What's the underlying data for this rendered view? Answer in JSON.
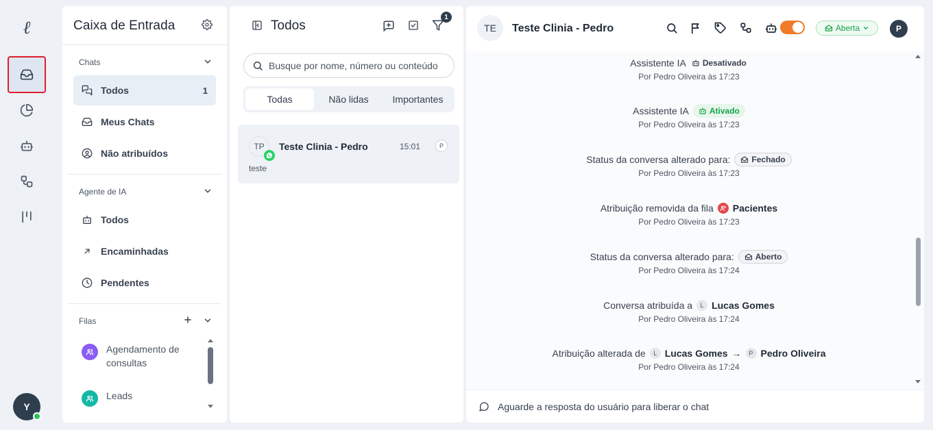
{
  "rail": {
    "logo": "ℓ",
    "items": [
      {
        "icon": "inbox-icon",
        "active": true
      },
      {
        "icon": "pie-chart-icon"
      },
      {
        "icon": "bot-icon"
      },
      {
        "icon": "workflow-icon"
      },
      {
        "icon": "kanban-icon"
      }
    ],
    "user_initial": "Y"
  },
  "inbox": {
    "title": "Caixa de Entrada",
    "chats_section": "Chats",
    "chats_items": [
      {
        "label": "Todos",
        "count": "1"
      },
      {
        "label": "Meus Chats"
      },
      {
        "label": "Não atribuídos"
      }
    ],
    "ai_section": "Agente de IA",
    "ai_items": [
      {
        "label": "Todos"
      },
      {
        "label": "Encaminhadas"
      },
      {
        "label": "Pendentes"
      }
    ],
    "queues_section": "Filas",
    "queues": [
      {
        "label": "Agendamento de consultas",
        "color": "#8b5cf6"
      },
      {
        "label": "Leads",
        "color": "#14b8a6"
      }
    ]
  },
  "list": {
    "title": "Todos",
    "filter_badge": "1",
    "search_placeholder": "Busque por nome, número ou conteúdo",
    "tabs": [
      "Todas",
      "Não lidas",
      "Importantes"
    ],
    "conversations": [
      {
        "initials": "TP",
        "name": "Teste Clinia - Pedro",
        "time": "15:01",
        "assignee": "P",
        "preview": "teste"
      }
    ]
  },
  "chat": {
    "initials": "TE",
    "title": "Teste Clinia - Pedro",
    "status": "Aberta",
    "user_initial": "P",
    "events": [
      {
        "text": "Assistente IA",
        "chip": "Desativado",
        "by": "Por Pedro Oliveira às 17:23"
      },
      {
        "text": "Assistente IA",
        "chip": "Ativado",
        "by": "Por Pedro Oliveira às 17:23"
      },
      {
        "text": "Status da conversa alterado para:",
        "chip": "Fechado",
        "by": "Por Pedro Oliveira às 17:23"
      },
      {
        "text": "Atribuição removida da fila",
        "chip": "Pacientes",
        "by": "Por Pedro Oliveira às 17:23"
      },
      {
        "text": "Status da conversa alterado para:",
        "chip": "Aberto",
        "by": "Por Pedro Oliveira às 17:24"
      },
      {
        "text": "Conversa atribuída a",
        "initial": "L",
        "chip": "Lucas Gomes",
        "by": "Por Pedro Oliveira às 17:24"
      },
      {
        "text": "Atribuição alterada de",
        "initial": "L",
        "from": "Lucas Gomes",
        "arrow": "→",
        "initial2": "P",
        "to": "Pedro Oliveira",
        "by": "Por Pedro Oliveira às 17:24"
      }
    ],
    "footer": "Aguarde a resposta do usuário para liberar o chat"
  }
}
